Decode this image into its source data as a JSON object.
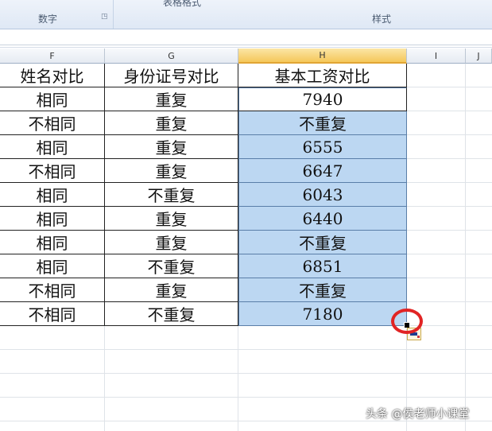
{
  "ribbon": {
    "group_number_label": "数字",
    "group_style_label": "样式",
    "partial_label": "表格格式"
  },
  "columns": [
    {
      "id": "F",
      "label": "F"
    },
    {
      "id": "G",
      "label": "G"
    },
    {
      "id": "H",
      "label": "H"
    },
    {
      "id": "I",
      "label": "I"
    },
    {
      "id": "J",
      "label": "J"
    }
  ],
  "table": {
    "headers": [
      "姓名对比",
      "身份证号对比",
      "基本工资对比"
    ],
    "rows": [
      [
        "相同",
        "重复",
        "7940"
      ],
      [
        "不相同",
        "重复",
        "不重复"
      ],
      [
        "相同",
        "重复",
        "6555"
      ],
      [
        "不相同",
        "重复",
        "6647"
      ],
      [
        "相同",
        "不重复",
        "6043"
      ],
      [
        "相同",
        "重复",
        "6440"
      ],
      [
        "相同",
        "重复",
        "不重复"
      ],
      [
        "相同",
        "不重复",
        "6851"
      ],
      [
        "不相同",
        "重复",
        "不重复"
      ],
      [
        "不相同",
        "不重复",
        "7180"
      ]
    ]
  },
  "watermark": "头条 @侯老师小课堂",
  "colors": {
    "selection_fill": "#bcd7f2",
    "selected_header": "#f5c75a",
    "annotation_circle": "#e12424"
  }
}
